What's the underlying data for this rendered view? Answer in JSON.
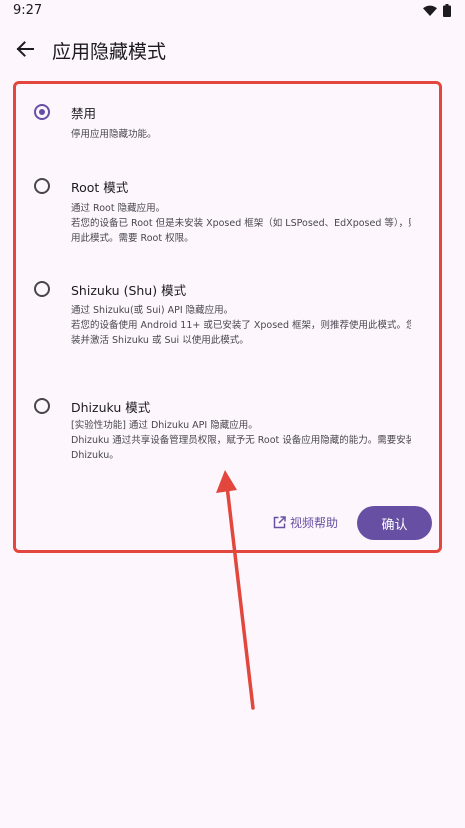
{
  "status_bar": {
    "time": "9:27"
  },
  "app_bar": {
    "title": "应用隐藏模式"
  },
  "options": [
    {
      "title": "禁用",
      "selected": true,
      "description": [
        "停用应用隐藏功能。"
      ]
    },
    {
      "title": "Root 模式",
      "selected": false,
      "description": [
        "通过 Root 隐藏应用。",
        "若您的设备已 Root 但是未安装 Xposed 框架（如 LSPosed、EdXposed 等），则推荐使",
        "用此模式。需要 Root 权限。"
      ]
    },
    {
      "title": "Shizuku (Shu) 模式",
      "selected": false,
      "description": [
        "通过 Shizuku(或 Sui) API 隐藏应用。",
        "若您的设备使用 Android 11+ 或已安装了 Xposed 框架，则推荐使用此模式。您需要先安",
        "装并激活 Shizuku 或 Sui 以使用此模式。"
      ]
    },
    {
      "title": "Dhizuku 模式",
      "selected": false,
      "description": [
        "[实验性功能] 通过 Dhizuku API 隐藏应用。",
        "Dhizuku 通过共享设备管理员权限，赋予无 Root 设备应用隐藏的能力。需要安装并激活",
        "Dhizuku。"
      ]
    }
  ],
  "actions": {
    "help_label": "视频帮助",
    "confirm_label": "确认"
  },
  "colors": {
    "accent": "#6750a4",
    "highlight": "#e2463c",
    "background": "#fdf7fd"
  },
  "icons": {
    "back": "arrow-back-icon",
    "wifi": "wifi-icon",
    "battery": "battery-icon",
    "help": "open-in-new-icon"
  }
}
